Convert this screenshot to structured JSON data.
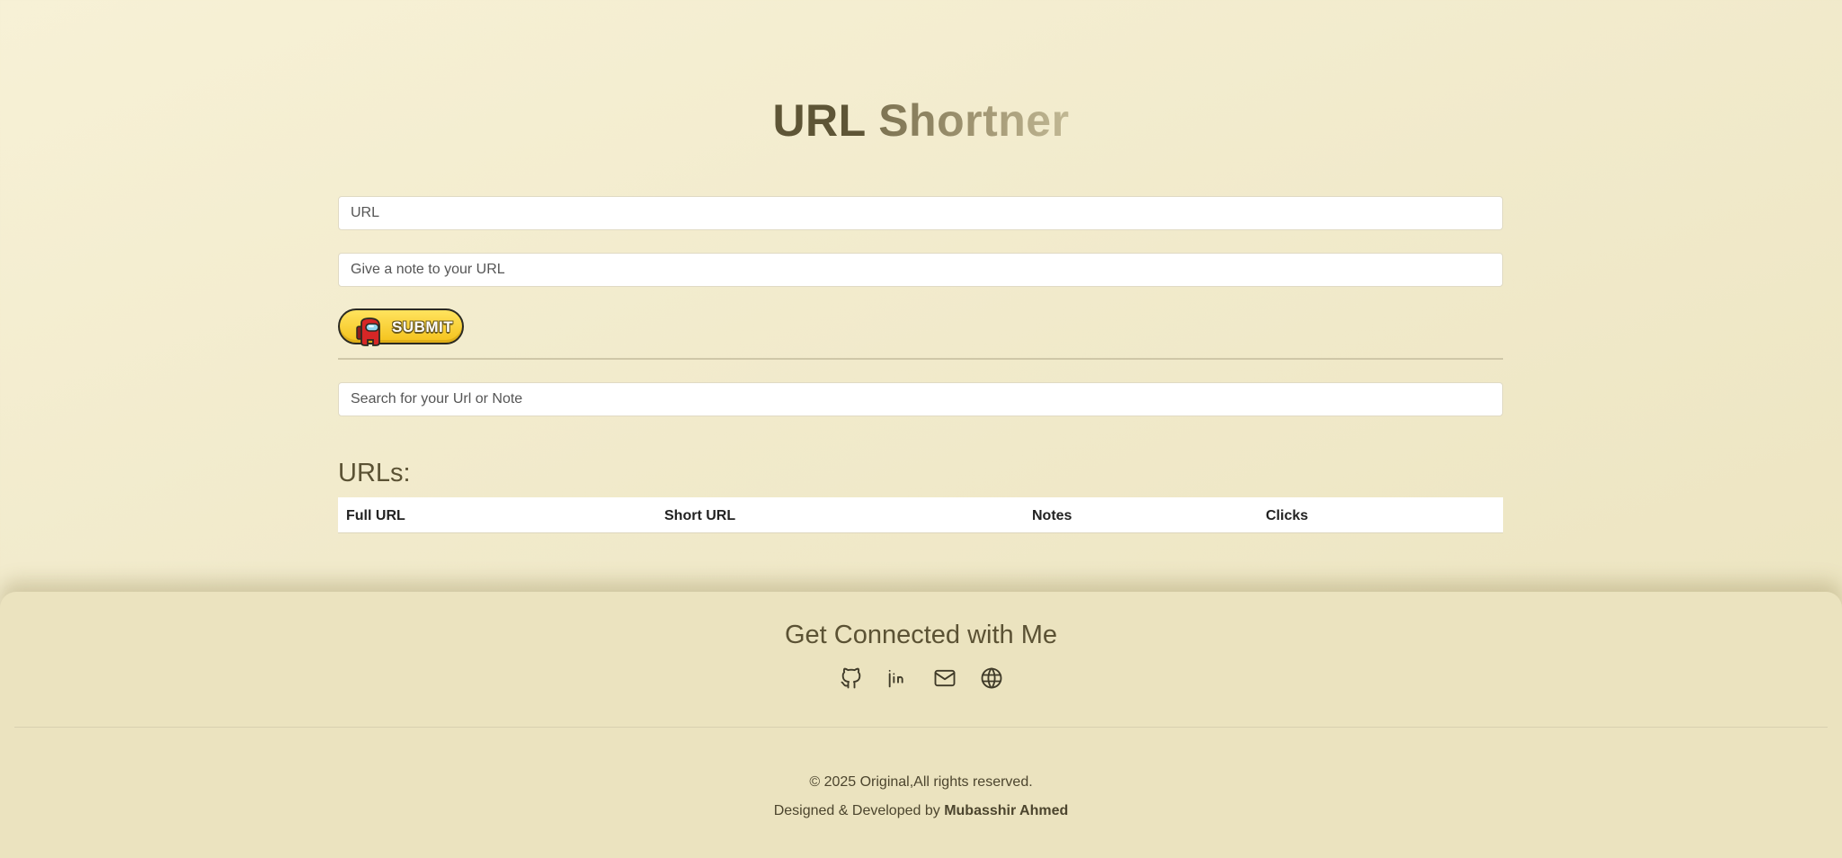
{
  "header": {
    "title_part1": "URL",
    "title_part2": "Shortner"
  },
  "form": {
    "url_placeholder": "URL",
    "note_placeholder": "Give a note to your URL",
    "submit_label": "SUBMIT",
    "search_placeholder": "Search for your Url or Note"
  },
  "urls": {
    "heading": "URLs:",
    "columns": [
      "Full URL",
      "Short URL",
      "Notes",
      "Clicks"
    ],
    "rows": []
  },
  "footer": {
    "title": "Get Connected with Me",
    "social_icons": [
      "github-icon",
      "linkedin-icon",
      "mail-icon",
      "globe-icon"
    ],
    "copyright": "© 2025 Original,All rights reserved.",
    "credit_prefix": "Designed & Developed by",
    "credit_name": "Mubasshir Ahmed"
  },
  "colors": {
    "background": "#f3ecce",
    "title_dark": "#5e5536",
    "submit_yellow": "#f9d43a",
    "footer_bg": "#ebe3bf"
  }
}
